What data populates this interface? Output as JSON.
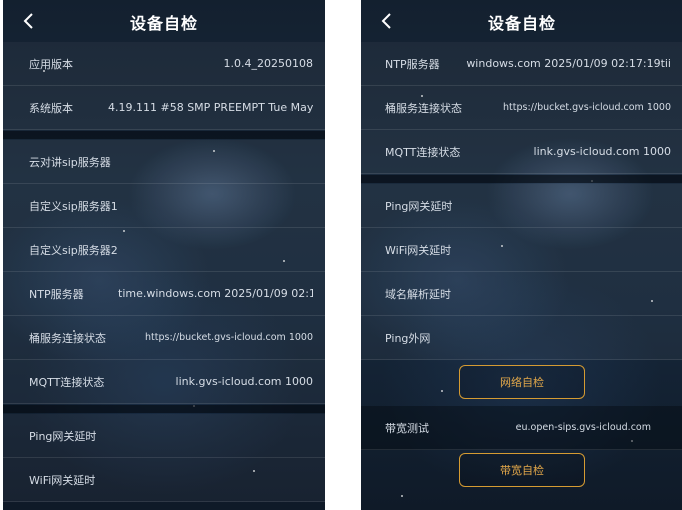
{
  "left": {
    "header": {
      "title": "设备自检"
    },
    "info_rows": [
      {
        "label": "应用版本",
        "value": "1.0.4_20250108"
      },
      {
        "label": "系统版本",
        "value": "4.19.111 #58 SMP PREEMPT Tue May"
      }
    ],
    "server_rows": [
      {
        "label": "云对讲sip服务器",
        "value": ""
      },
      {
        "label": "自定义sip服务器1",
        "value": ""
      },
      {
        "label": "自定义sip服务器2",
        "value": ""
      },
      {
        "label": "NTP服务器",
        "value": "time.windows.com 2025/01/09 02:1"
      },
      {
        "label": "桶服务连接状态",
        "value": "https://bucket.gvs-icloud.com 1000"
      },
      {
        "label": "MQTT连接状态",
        "value": "link.gvs-icloud.com 1000"
      }
    ],
    "network_rows": [
      {
        "label": "Ping网关延时",
        "value": ""
      },
      {
        "label": "WiFi网关延时",
        "value": ""
      }
    ]
  },
  "right": {
    "header": {
      "title": "设备自检"
    },
    "server_rows": [
      {
        "label": "NTP服务器",
        "value": "windows.com 2025/01/09 02:17:19tii"
      },
      {
        "label": "桶服务连接状态",
        "value": "https://bucket.gvs-icloud.com 1000"
      },
      {
        "label": "MQTT连接状态",
        "value": "link.gvs-icloud.com 1000"
      }
    ],
    "network_rows": [
      {
        "label": "Ping网关延时",
        "value": ""
      },
      {
        "label": "WiFi网关延时",
        "value": ""
      },
      {
        "label": "域名解析延时",
        "value": ""
      },
      {
        "label": "Ping外网",
        "value": ""
      }
    ],
    "network_button": "网络自检",
    "bandwidth_row": {
      "label": "带宽测试",
      "value": "eu.open-sips.gvs-icloud.com"
    },
    "bandwidth_button": "带宽自检"
  },
  "colors": {
    "accent": "#d59b32",
    "text": "#d6dde6",
    "background": "#16273a"
  },
  "icons": {
    "back": "chevron-left-icon"
  }
}
